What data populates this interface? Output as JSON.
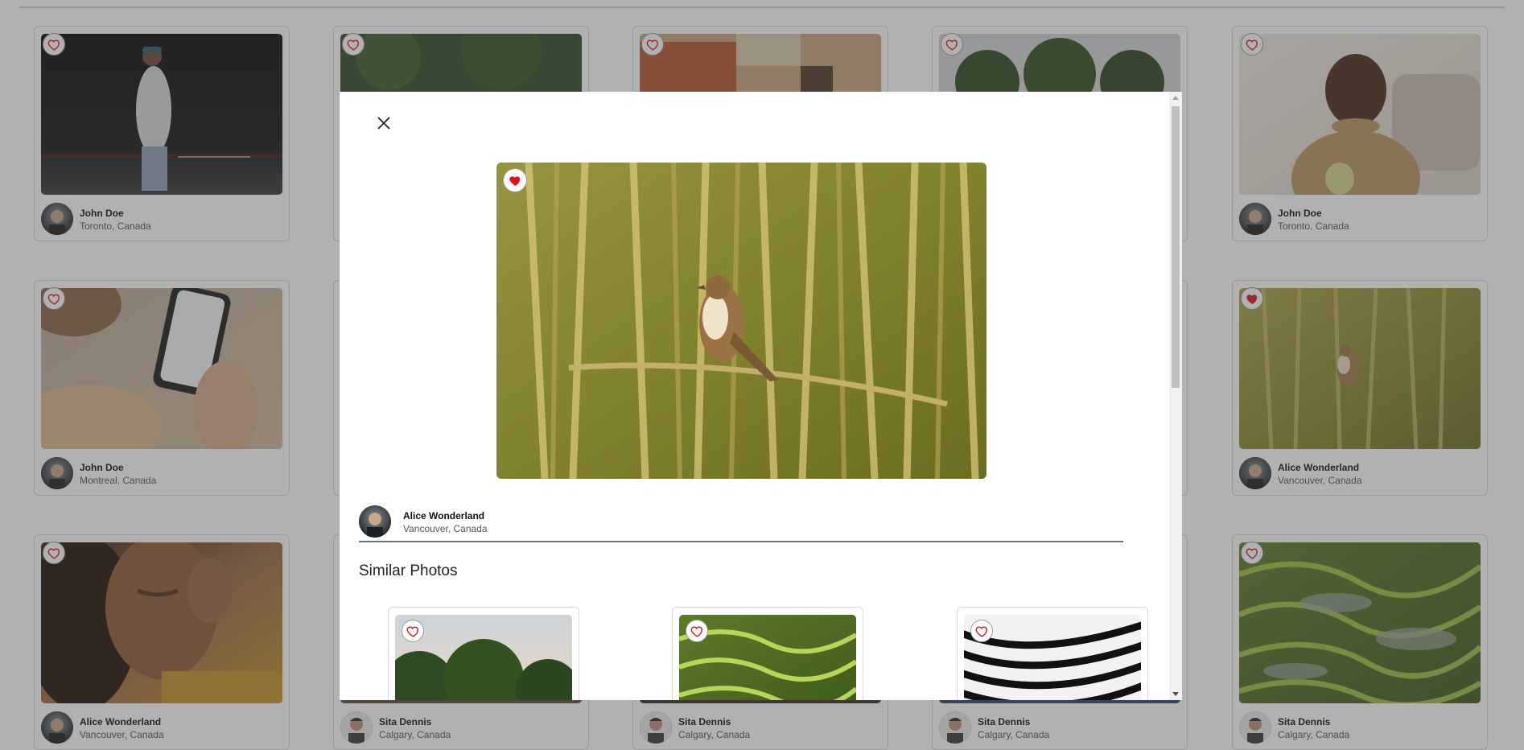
{
  "accent": {
    "heart_red": "#d9141e",
    "heart_outline": "#d9141e"
  },
  "grid": {
    "cards": [
      {
        "name": "John Doe",
        "location": "Toronto, Canada",
        "liked": false,
        "scene": "night-street"
      },
      {
        "name": "",
        "location": "",
        "liked": false,
        "scene": "forest"
      },
      {
        "name": "",
        "location": "",
        "liked": false,
        "scene": "city-buildings"
      },
      {
        "name": "",
        "location": "",
        "liked": false,
        "scene": "trees-sunset"
      },
      {
        "name": "John Doe",
        "location": "Toronto, Canada",
        "liked": false,
        "scene": "smiling-man"
      },
      {
        "name": "John Doe",
        "location": "Montreal, Canada",
        "liked": false,
        "scene": "phone-hand"
      },
      {
        "name": "Alice Wonderland",
        "location": "Vancouver, Canada",
        "liked": true,
        "scene": "bird-reeds"
      },
      {
        "name": "Alice Wonderland",
        "location": "Vancouver, Canada",
        "liked": false,
        "scene": "woman-portrait"
      },
      {
        "name": "Sita Dennis",
        "location": "Calgary, Canada",
        "liked": false,
        "scene": ""
      },
      {
        "name": "Sita Dennis",
        "location": "Calgary, Canada",
        "liked": false,
        "scene": ""
      },
      {
        "name": "Sita Dennis",
        "location": "Calgary, Canada",
        "liked": false,
        "scene": ""
      },
      {
        "name": "Sita Dennis",
        "location": "Calgary, Canada",
        "liked": false,
        "scene": "rice-terraces"
      }
    ]
  },
  "modal": {
    "close_icon": "close-icon",
    "photo": {
      "liked": true,
      "scene": "bird-reeds"
    },
    "author": {
      "name": "Alice Wonderland",
      "location": "Vancouver, Canada"
    },
    "similar_title": "Similar Photos",
    "similar": [
      {
        "scene": "trees-sunset",
        "liked": false
      },
      {
        "scene": "rice-terraces",
        "liked": false
      },
      {
        "scene": "zebra",
        "liked": false
      }
    ]
  }
}
